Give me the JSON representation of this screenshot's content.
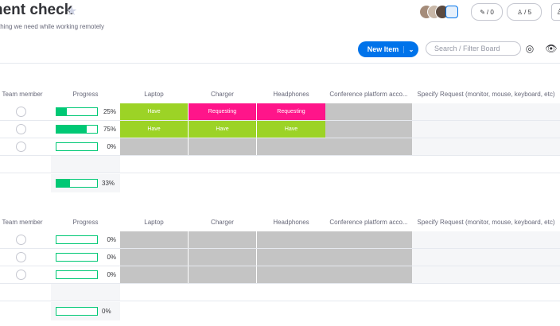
{
  "header": {
    "title": "nent check",
    "subtitle": "thing we need while working remotely",
    "activity_count": "/ 0",
    "members_count": "/ 5"
  },
  "toolbar": {
    "new_item_label": "New Item",
    "search_placeholder": "Search / Filter Board"
  },
  "columns": [
    "Team member",
    "Progress",
    "Laptop",
    "Charger",
    "Headphones",
    "Conference platform acco...",
    "Specify Request (monitor, mouse, keyboard, etc)"
  ],
  "groups": [
    {
      "rows": [
        {
          "progress": 0.25,
          "progress_label": "25%",
          "laptop": "Have",
          "charger": "Requesting",
          "headphones": "Requesting"
        },
        {
          "progress": 0.75,
          "progress_label": "75%",
          "laptop": "Have",
          "charger": "Have",
          "headphones": "Have"
        },
        {
          "progress": 0,
          "progress_label": "0%",
          "laptop": "",
          "charger": "",
          "headphones": ""
        }
      ],
      "summary": {
        "progress": 0.33,
        "label": "33%"
      }
    },
    {
      "rows": [
        {
          "progress": 0,
          "progress_label": "0%",
          "laptop": "",
          "charger": "",
          "headphones": ""
        },
        {
          "progress": 0,
          "progress_label": "0%",
          "laptop": "",
          "charger": "",
          "headphones": ""
        },
        {
          "progress": 0,
          "progress_label": "0%",
          "laptop": "",
          "charger": "",
          "headphones": ""
        }
      ],
      "summary": {
        "progress": 0,
        "label": "0%"
      }
    }
  ],
  "colors": {
    "have": "#9cd326",
    "requesting": "#ff158a",
    "empty": "#c4c4c4",
    "progress": "#00c875",
    "accent": "#0073ea"
  },
  "icons": [
    "star-icon",
    "activity-icon",
    "members-icon",
    "user-icon",
    "chevron-down-icon",
    "person-icon",
    "eye-icon"
  ]
}
